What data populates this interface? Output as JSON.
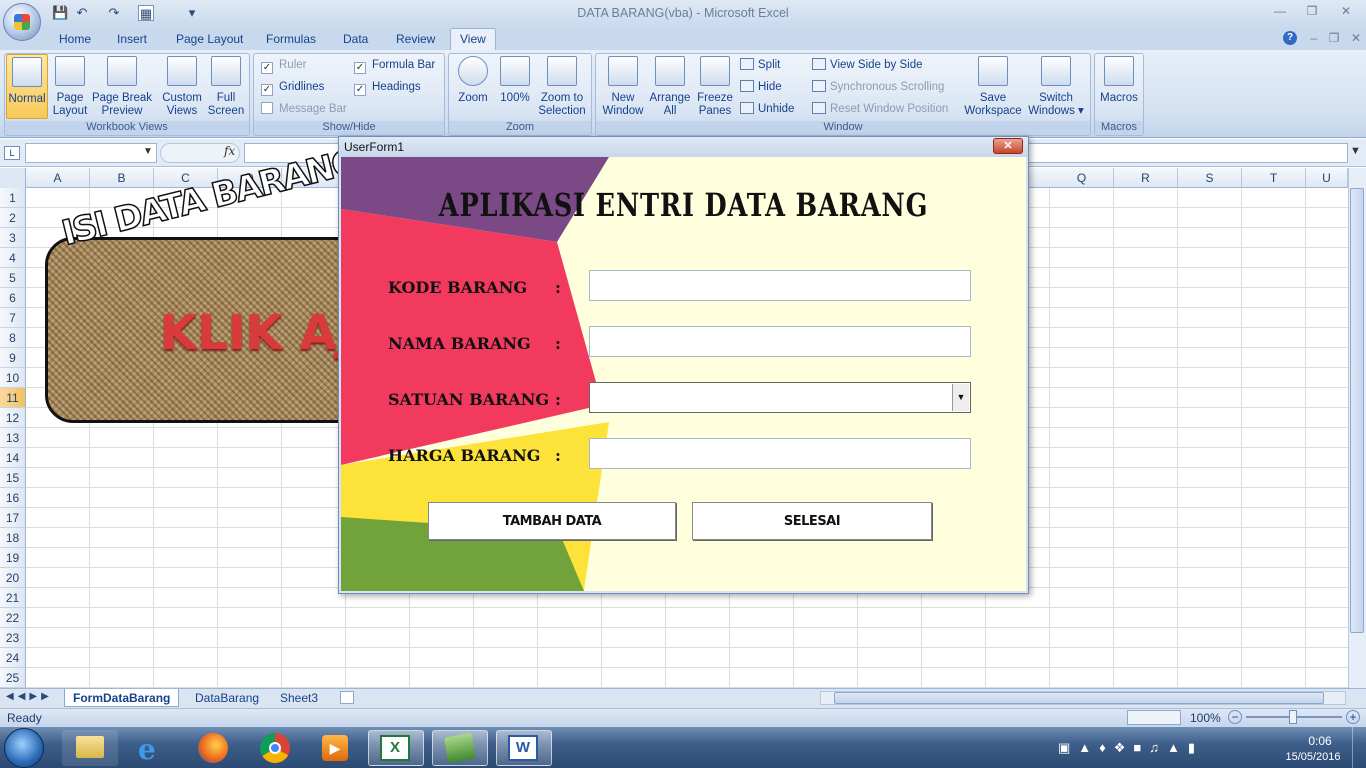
{
  "window": {
    "title": "DATA BARANG(vba) - Microsoft Excel"
  },
  "tabs": [
    "Home",
    "Insert",
    "Page Layout",
    "Formulas",
    "Data",
    "Review",
    "View"
  ],
  "ribbon": {
    "workbook_views": {
      "label": "Workbook Views",
      "normal": "Normal",
      "page_layout": "Page Layout",
      "page_break": "Page Break Preview",
      "custom": "Custom Views",
      "full": "Full Screen"
    },
    "show_hide": {
      "label": "Show/Hide",
      "ruler": "Ruler",
      "gridlines": "Gridlines",
      "message_bar": "Message Bar",
      "formula_bar": "Formula Bar",
      "headings": "Headings"
    },
    "zoom": {
      "label": "Zoom",
      "zoom": "Zoom",
      "pct": "100%",
      "selection": "Zoom to Selection"
    },
    "window": {
      "label": "Window",
      "new_window": "New Window",
      "arrange_all": "Arrange All",
      "freeze": "Freeze Panes",
      "split": "Split",
      "hide": "Hide",
      "unhide": "Unhide",
      "side": "View Side by Side",
      "sync": "Synchronous Scrolling",
      "reset": "Reset Window Position",
      "save_ws": "Save Workspace",
      "switch": "Switch Windows"
    },
    "macros": {
      "label": "Macros",
      "macros": "Macros"
    }
  },
  "formula": {
    "fx": "fx"
  },
  "columns": [
    "A",
    "B",
    "C",
    "D",
    "E",
    "Q",
    "R",
    "S",
    "T",
    "U"
  ],
  "rows": [
    "1",
    "2",
    "3",
    "4",
    "5",
    "6",
    "7",
    "8",
    "9",
    "10",
    "11",
    "12",
    "13",
    "14",
    "15",
    "16",
    "17",
    "18",
    "19",
    "20",
    "21",
    "22",
    "23",
    "24",
    "25"
  ],
  "banner": {
    "arc_text": "ISI DATA BARANG",
    "klik": "KLIK AJ"
  },
  "sheets": [
    "FormDataBarang",
    "DataBarang",
    "Sheet3"
  ],
  "status": {
    "ready": "Ready",
    "zoom": "100%"
  },
  "userform": {
    "title": "UserForm1",
    "heading": "APLIKASI  ENTRI  DATA  BARANG",
    "labels": [
      "KODE BARANG",
      "NAMA BARANG",
      "SATUAN BARANG",
      "HARGA BARANG"
    ],
    "colon": ":",
    "btn_add": "TAMBAH DATA",
    "btn_done": "SELESAI"
  },
  "clock": {
    "time": "0:06",
    "date": "15/05/2016"
  },
  "colors": {
    "purple": "#7b4a86",
    "red": "#f23a5f",
    "yellow": "#fde23a",
    "green": "#72a23a",
    "form_bg": "#ffffdd"
  }
}
